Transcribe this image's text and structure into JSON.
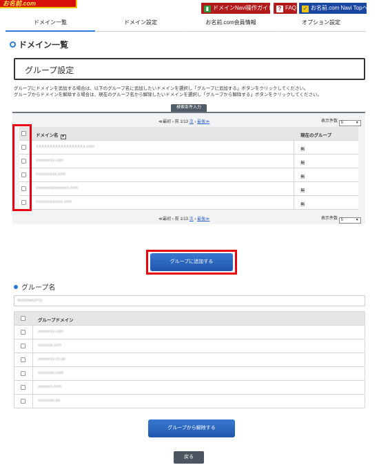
{
  "header": {
    "logo_text": "お名前.com",
    "links": [
      {
        "icon": "guide-book-icon",
        "label": "ドメインNavi操作ガイド"
      },
      {
        "icon": "question-icon",
        "label": "FAQ"
      },
      {
        "icon": "navi-top-icon",
        "label": "お名前.com Navi Topへ"
      }
    ]
  },
  "nav": {
    "tabs": [
      {
        "label": "ドメイン一覧",
        "active": true
      },
      {
        "label": "ドメイン設定",
        "active": false
      },
      {
        "label": "お名前.com会員情報",
        "active": false
      },
      {
        "label": "オプション設定",
        "active": false
      }
    ]
  },
  "page": {
    "title": "ドメイン一覧",
    "group_box_title": "グループ設定",
    "desc_line1": "グループにドメインを追加する場合は、以下のグループ名に追加したいドメインを選択し「グループに追加する」ボタンをクリックしてください。",
    "desc_line2": "グループからドメインを解除する場合は、現在のグループ名から解除したいドメインを選択し「グループから解除する」ボタンをクリックしてください。",
    "search_tab": "検索条件入力"
  },
  "domain_table": {
    "pager": {
      "first": "≪最初",
      "prev": "前",
      "page": "1/13",
      "next": "次",
      "last": "最後≫"
    },
    "per_page_label": "表示件数",
    "per_page_value": "5",
    "col_domain": "ドメイン名",
    "col_group": "現在のグループ",
    "rows": [
      {
        "domain": "XXXXXXXXXXXXXXXXXX.com",
        "group": "無"
      },
      {
        "domain": "xxxxxxxxx.com",
        "group": "無"
      },
      {
        "domain": "xxxxxxxxxx.com",
        "group": "無"
      },
      {
        "domain": "xxxxxxxxxxxxxxxx.com",
        "group": "無"
      },
      {
        "domain": "xxxxxxxxxxxxx.com",
        "group": "無"
      }
    ],
    "highlight_color": "#e60012"
  },
  "actions": {
    "add_to_group": "グループに追加する",
    "remove_from_group": "グループから解除する",
    "back": "戻る"
  },
  "group_section": {
    "title": "グループ名",
    "group_name_value": "Windows(PS)",
    "col_domain": "グループドメイン",
    "rows": [
      {
        "domain": "xxxxxxxx.com"
      },
      {
        "domain": "xxxxxxx.com"
      },
      {
        "domain": "xxxxxxxx.co.uk"
      },
      {
        "domain": "xxxxxxxx.com"
      },
      {
        "domain": "xxxxxxx.com"
      },
      {
        "domain": "xxxxxxxx.de"
      }
    ]
  },
  "colors": {
    "accent": "#2b7bd6",
    "brand_red": "#d8100b",
    "button_blue": "#1f56ad",
    "highlight": "#e60012"
  }
}
